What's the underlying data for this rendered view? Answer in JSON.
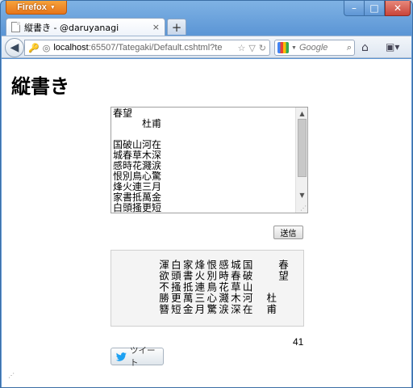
{
  "browser": {
    "app_button": "Firefox",
    "tab": {
      "title": "縦書き - @daruyanagi",
      "close": "×"
    },
    "new_tab": "+",
    "url_host": "localhost",
    "url_rest": ":65507/Tategaki/Default.cshtml?te",
    "search_placeholder": "Google",
    "window_controls": {
      "minimize": "–",
      "maximize": "□",
      "close": "✕"
    }
  },
  "page": {
    "title": "縦書き",
    "input_text": "春望\n　　　杜甫\n\n国破山河在\n城春草木深\n感時花濺涙\n恨別鳥心驚\n烽火連三月\n家書抵萬金\n白頭搔更短",
    "submit_label": "送信",
    "vertical_text": "春望\n　　　杜甫\n\n国破山河在\n城春草木深\n感時花濺涙\n恨別鳥心驚\n烽火連三月\n家書抵萬金\n白頭搔更短\n渾欲不勝簪",
    "char_count": "41",
    "tweet_label": "ツイート"
  },
  "colors": {
    "firefox_orange": "#e7751a",
    "window_blue": "#5d97d6",
    "twitter_blue": "#1da1f2"
  }
}
